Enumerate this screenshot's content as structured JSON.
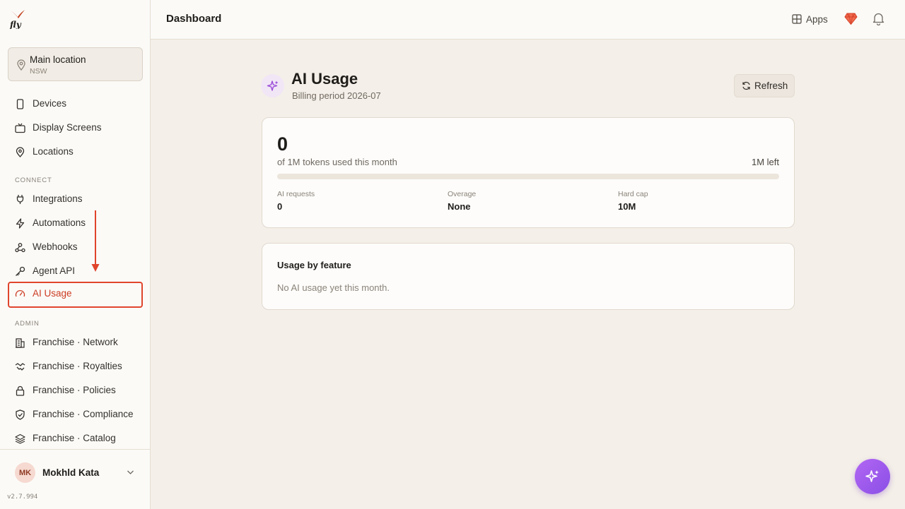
{
  "brand": {
    "logo_text": "fly"
  },
  "location": {
    "name": "Main location",
    "region": "NSW"
  },
  "nav": {
    "main": [
      {
        "label": "Devices",
        "icon": "phone-icon"
      },
      {
        "label": "Display Screens",
        "icon": "tv-icon"
      },
      {
        "label": "Locations",
        "icon": "map-pin-icon"
      }
    ],
    "connect_label": "CONNECT",
    "connect": [
      {
        "label": "Integrations",
        "icon": "plug-icon"
      },
      {
        "label": "Automations",
        "icon": "lightning-icon"
      },
      {
        "label": "Webhooks",
        "icon": "webhook-icon"
      },
      {
        "label": "Agent API",
        "icon": "key-icon"
      },
      {
        "label": "AI Usage",
        "icon": "gauge-icon",
        "active": true
      }
    ],
    "admin_label": "ADMIN",
    "admin": [
      {
        "label": "Franchise · Network",
        "icon": "building-icon"
      },
      {
        "label": "Franchise · Royalties",
        "icon": "handshake-icon"
      },
      {
        "label": "Franchise · Policies",
        "icon": "lock-icon"
      },
      {
        "label": "Franchise · Compliance",
        "icon": "shield-check-icon"
      },
      {
        "label": "Franchise · Catalog",
        "icon": "layers-icon"
      }
    ]
  },
  "user": {
    "initials": "MK",
    "name": "Mokhld Kata",
    "version": "v2.7.994"
  },
  "header": {
    "title": "Dashboard",
    "apps_label": "Apps"
  },
  "page": {
    "title": "AI Usage",
    "subtitle": "Billing period 2026-07",
    "refresh_label": "Refresh"
  },
  "usage": {
    "tokens_used": "0",
    "tokens_caption": "of 1M tokens used this month",
    "tokens_left": "1M left",
    "progress_fraction": 0,
    "stats": [
      {
        "label": "AI requests",
        "value": "0"
      },
      {
        "label": "Overage",
        "value": "None"
      },
      {
        "label": "Hard cap",
        "value": "10M"
      }
    ]
  },
  "feature_usage": {
    "heading": "Usage by feature",
    "empty_text": "No AI usage yet this month."
  },
  "colors": {
    "accent": "#a855f7",
    "highlight": "#e0452c",
    "background": "#f4efe8",
    "sidebar": "#fbfaf7"
  }
}
